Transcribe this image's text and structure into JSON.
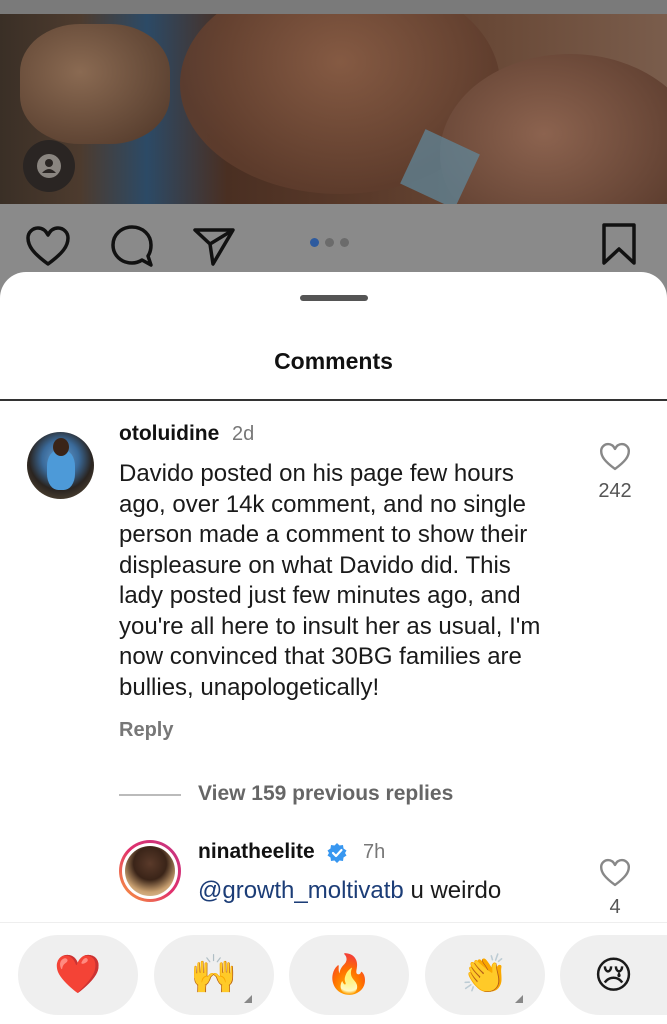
{
  "sheet": {
    "title": "Comments"
  },
  "comment": {
    "username": "otoluidine",
    "time": "2d",
    "lines": [
      "Davido posted on his page few hours",
      "ago, over 14k comment, and no single",
      "person made a comment to show their",
      "displeasure on what Davido did. This",
      "lady posted just few minutes ago, and",
      "you're all here to insult her as usual, I'm",
      "now convinced that 30BG families are",
      "bullies, unapologetically!"
    ],
    "likes": "242",
    "reply_label": "Reply"
  },
  "view_replies": "View 159 previous replies",
  "reply": {
    "username": "ninatheelite",
    "time": "7h",
    "mention": "@growth_moltivatb",
    "text": " u weirdo",
    "likes": "4"
  },
  "reactions": [
    {
      "emoji": "❤️",
      "name": "heart"
    },
    {
      "emoji": "🙌",
      "name": "raised-hands"
    },
    {
      "emoji": "🔥",
      "name": "fire"
    },
    {
      "emoji": "👏",
      "name": "clapping-hands"
    },
    {
      "emoji": "😢",
      "name": "crying-face"
    }
  ],
  "colors": {
    "mention": "#1c3d77",
    "verified": "#3897f0",
    "carousel_active": "#2d5a9e"
  }
}
